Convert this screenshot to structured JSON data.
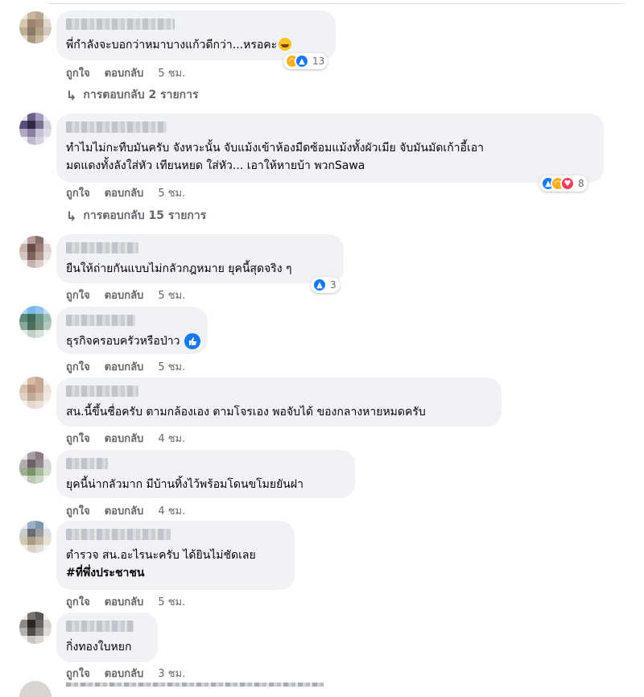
{
  "labels": {
    "like": "ถูกใจ",
    "reply": "ตอบกลับ"
  },
  "comments": [
    {
      "text_lines": [
        "พี่กำลังจะบอกว่าหมาบางแก้วดีกว่า...หรอคะ"
      ],
      "has_laugh_emoji": true,
      "time": "5 ชม.",
      "reactions": [
        "haha",
        "like"
      ],
      "reaction_count": "13",
      "replies": "การตอบกลับ 2 รายการ"
    },
    {
      "text_lines": [
        "ทำไมไม่กะทืบมันครับ จังหวะนั้น จับแม้งเข้าห้องมืดซ้อมแม้งทั้งผัวเมีย จับมันมัดเก้าอี้เอา",
        "มดแดงทั้งลังใส่หัว เทียนหยด ใส่หัว... เอาให้หายบ้า พวกSawa"
      ],
      "time": "5 ชม.",
      "reactions": [
        "like",
        "haha",
        "love"
      ],
      "reaction_count": "8",
      "replies": "การตอบกลับ 15 รายการ"
    },
    {
      "text_lines": [
        "ยืนให้ถ่ายกันแบบไม่กลัวกฎหมาย ยุคนี้สุดจริง ๆ"
      ],
      "time": "5 ชม.",
      "reactions": [
        "like"
      ],
      "reaction_count": "3"
    },
    {
      "text_lines": [
        "ธุรกิจครอบครัวหรือป่าว"
      ],
      "time": "5 ชม.",
      "inline_like": true
    },
    {
      "text_lines": [
        "สน.นี้ขึ้นชื่อครับ ตามกล้องเอง ตามโจรเอง พอจับได้ ของกลางหายหมดครับ"
      ],
      "time": "4 ชม."
    },
    {
      "text_lines": [
        "ยุคนี้น่ากลัวมาก มีบ้านทิ้งไว้พร้อมโดนขโมยยันฝา"
      ],
      "time": "4 ชม."
    },
    {
      "text_lines": [
        "ตำรวจ สน.อะไรนะครับ ได้ยินไม่ชัดเลย",
        "#ที่พึ่งประชาชน"
      ],
      "time": "5 ชม."
    },
    {
      "text_lines": [
        "กิ่งทองใบหยก"
      ],
      "time": "3 ชม."
    }
  ],
  "colors": {
    "bubble": "#f0f2f5",
    "meta": "#65676b",
    "like": "#1877f2",
    "haha": "#f7b125",
    "love": "#f33e58"
  }
}
